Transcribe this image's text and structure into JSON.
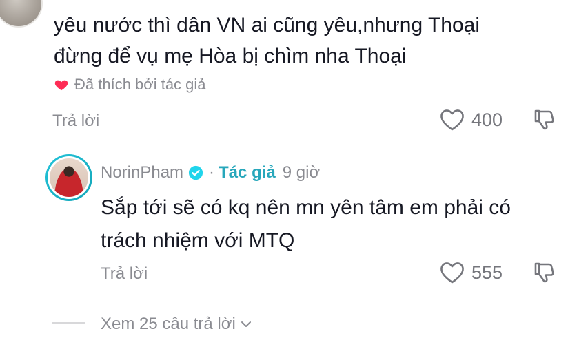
{
  "comment": {
    "text_line1": "yêu nước thì dân VN ai cũng yêu,nhưng Thoại",
    "text_line2": "đừng để vụ mẹ Hòa bị chìm nha Thoại",
    "liked_by_author": "Đã thích bởi tác giả",
    "reply_label": "Trả lời",
    "like_count": "400"
  },
  "reply": {
    "username": "NorinPham",
    "dot": "·",
    "author_badge": "Tác giả",
    "time": "9 giờ",
    "text_line1": "Sắp tới sẽ có kq nên mn yên tâm em phải có",
    "text_line2": "trách nhiệm với MTQ",
    "reply_label": "Trả lời",
    "like_count": "555"
  },
  "view_replies": {
    "label": "Xem 25 câu trả lời"
  },
  "colors": {
    "author_accent": "#27a7bb",
    "liked_heart": "#fe2c55",
    "muted_text": "#8a8b91"
  },
  "icons": {
    "liked": "heart-filled-icon",
    "like": "heart-outline-icon",
    "dislike": "thumb-down-outline-icon",
    "verified": "verified-check-icon",
    "expand": "chevron-down-icon"
  }
}
